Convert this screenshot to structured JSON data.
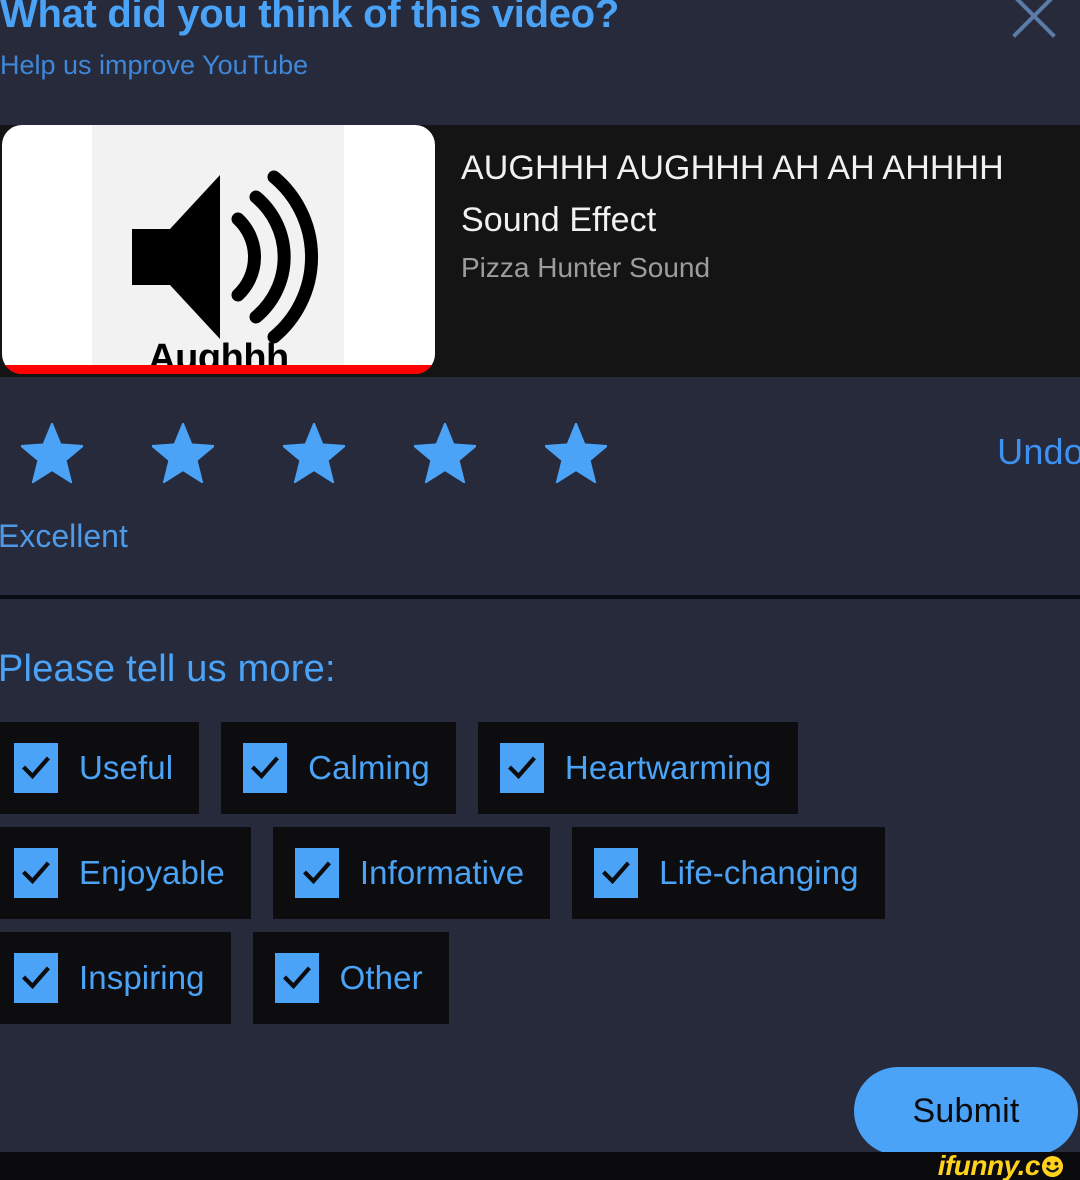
{
  "header": {
    "title": "What did you think of this video?",
    "subtitle": "Help us improve YouTube",
    "close_icon": "close-icon"
  },
  "video": {
    "title": "AUGHHH AUGHHH AH AH AHHHH Sound Effect",
    "channel": "Pizza Hunter Sound",
    "thumbnail": {
      "caption": "Aughhh",
      "icon": "speaker-icon",
      "progress_percent": 100,
      "progress_color": "#ff0000"
    }
  },
  "rating": {
    "stars_total": 5,
    "stars_selected": 5,
    "star_icon": "star-filled-icon",
    "star_color": "#4ba3f7",
    "undo_label": "Undo",
    "label": "Excellent"
  },
  "feedback": {
    "heading": "Please tell us more:",
    "check_icon": "checkmark-icon",
    "rows": [
      [
        {
          "label": "Useful",
          "checked": true
        },
        {
          "label": "Calming",
          "checked": true
        },
        {
          "label": "Heartwarming",
          "checked": true
        }
      ],
      [
        {
          "label": "Enjoyable",
          "checked": true
        },
        {
          "label": "Informative",
          "checked": true
        },
        {
          "label": "Life-changing",
          "checked": true
        }
      ],
      [
        {
          "label": "Inspiring",
          "checked": true
        },
        {
          "label": "Other",
          "checked": true
        }
      ]
    ]
  },
  "submit": {
    "label": "Submit",
    "color": "#4ba3f7"
  },
  "watermark": {
    "text": "ifunny.c",
    "icon": "smiley-face-icon",
    "color": "#ffd21e"
  },
  "theme": {
    "background": "#262a3b",
    "card_background": "#141414",
    "chip_background": "#0d0d10",
    "accent": "#4ba3f7"
  }
}
